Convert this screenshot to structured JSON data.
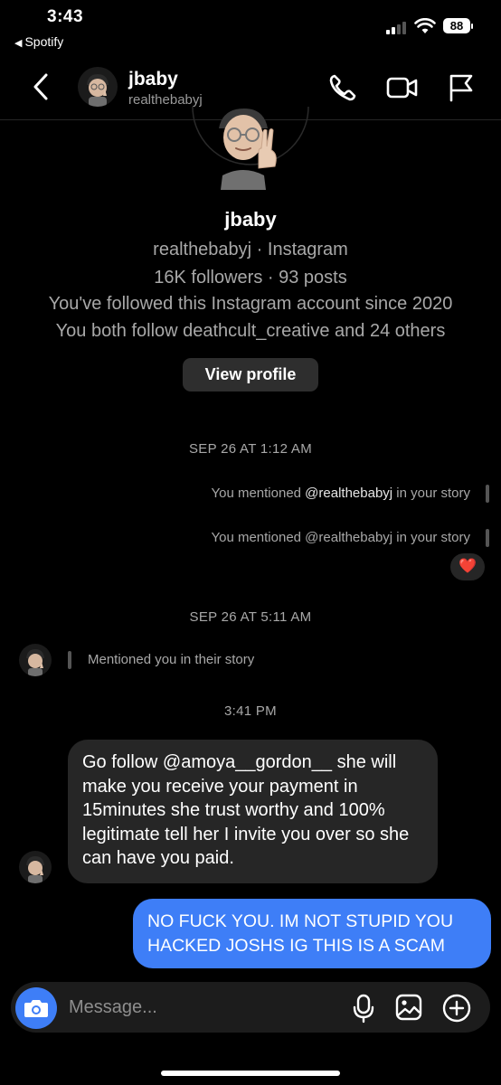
{
  "status_bar": {
    "time": "3:43",
    "back_app": "Spotify",
    "battery": "88"
  },
  "header": {
    "name": "jbaby",
    "username": "realthebabyj"
  },
  "profile": {
    "name": "jbaby",
    "source_line": "realthebabyj · Instagram",
    "stats": "16K followers · 93 posts",
    "followed_since": "You've followed this Instagram account since 2020",
    "mutuals": "You both follow deathcult_creative and 24 others",
    "view_profile_label": "View profile"
  },
  "conversation": {
    "stamp1": "SEP 26 AT 1:12 AM",
    "mention1_prefix": "You mentioned ",
    "mention1_handle": "@realthebabyj",
    "mention1_suffix": " in your story",
    "mention2": "You mentioned @realthebabyj in your story",
    "reaction": "❤️",
    "stamp2": "SEP 26 AT 5:11 AM",
    "incoming_mention": "Mentioned you in their story",
    "stamp3": "3:41 PM",
    "incoming_message": "Go follow @amoya__gordon__ she will make you receive your payment in 15minutes she trust worthy and 100% legitimate tell her I invite you over so she can have you paid.",
    "outgoing_message": "NO FUCK YOU. IM NOT STUPID YOU HACKED JOSHS IG THIS IS A SCAM"
  },
  "composer": {
    "placeholder": "Message..."
  },
  "colors": {
    "accent_blue": "#3e7ef7",
    "bubble_gray": "#262626",
    "secondary_text": "#a8a8a8",
    "heart_red": "#ff3040"
  }
}
